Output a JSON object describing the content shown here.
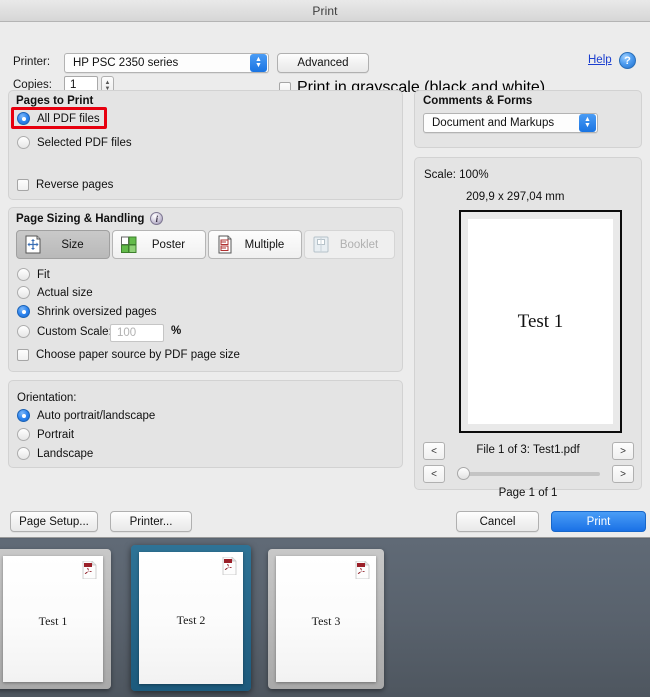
{
  "window": {
    "title": "Print"
  },
  "top": {
    "printer_label": "Printer:",
    "printer_value": "HP PSC 2350 series",
    "advanced_label": "Advanced",
    "copies_label": "Copies:",
    "copies_value": "1",
    "grayscale_label": "Print in grayscale (black and white)",
    "help_label": "Help",
    "help_icon_glyph": "?"
  },
  "pages_to_print": {
    "title": "Pages to Print",
    "options": [
      {
        "label": "All PDF files",
        "selected": true
      },
      {
        "label": "Selected PDF files",
        "selected": false
      }
    ],
    "reverse_label": "Reverse pages",
    "highlight_color": "#e7000f"
  },
  "page_sizing": {
    "title": "Page Sizing & Handling",
    "info_glyph": "i",
    "modes": [
      {
        "label": "Size",
        "icon": "size-icon",
        "state": "selected"
      },
      {
        "label": "Poster",
        "icon": "poster-icon",
        "state": "normal"
      },
      {
        "label": "Multiple",
        "icon": "multiple-icon",
        "state": "normal"
      },
      {
        "label": "Booklet",
        "icon": "booklet-icon",
        "state": "disabled"
      }
    ],
    "options": [
      {
        "label": "Fit",
        "selected": false
      },
      {
        "label": "Actual size",
        "selected": false
      },
      {
        "label": "Shrink oversized pages",
        "selected": true
      },
      {
        "label": "Custom Scale:",
        "selected": false
      }
    ],
    "custom_scale_value": "100",
    "percent_symbol": "%",
    "paper_source_label": "Choose paper source by PDF page size"
  },
  "orientation": {
    "title": "Orientation:",
    "options": [
      {
        "label": "Auto portrait/landscape",
        "selected": true
      },
      {
        "label": "Portrait",
        "selected": false
      },
      {
        "label": "Landscape",
        "selected": false
      }
    ]
  },
  "comments_forms": {
    "title": "Comments & Forms",
    "value": "Document and Markups"
  },
  "preview": {
    "scale_text": "Scale: 100%",
    "dimensions": "209,9 x 297,04 mm",
    "page_text": "Test 1",
    "file_nav_text": "File 1 of 3: Test1.pdf",
    "page_nav_text": "Page 1 of 1",
    "prev_glyph": "<",
    "next_glyph": ">"
  },
  "footer": {
    "page_setup_label": "Page Setup...",
    "printer_label": "Printer...",
    "cancel_label": "Cancel",
    "print_label": "Print",
    "print_accent": "#1a71e6"
  },
  "thumbnails": [
    {
      "label": "Test 1",
      "selected": false,
      "icon": "pdf-file-icon"
    },
    {
      "label": "Test 2",
      "selected": true,
      "icon": "pdf-file-icon"
    },
    {
      "label": "Test 3",
      "selected": false,
      "icon": "pdf-file-icon"
    }
  ]
}
